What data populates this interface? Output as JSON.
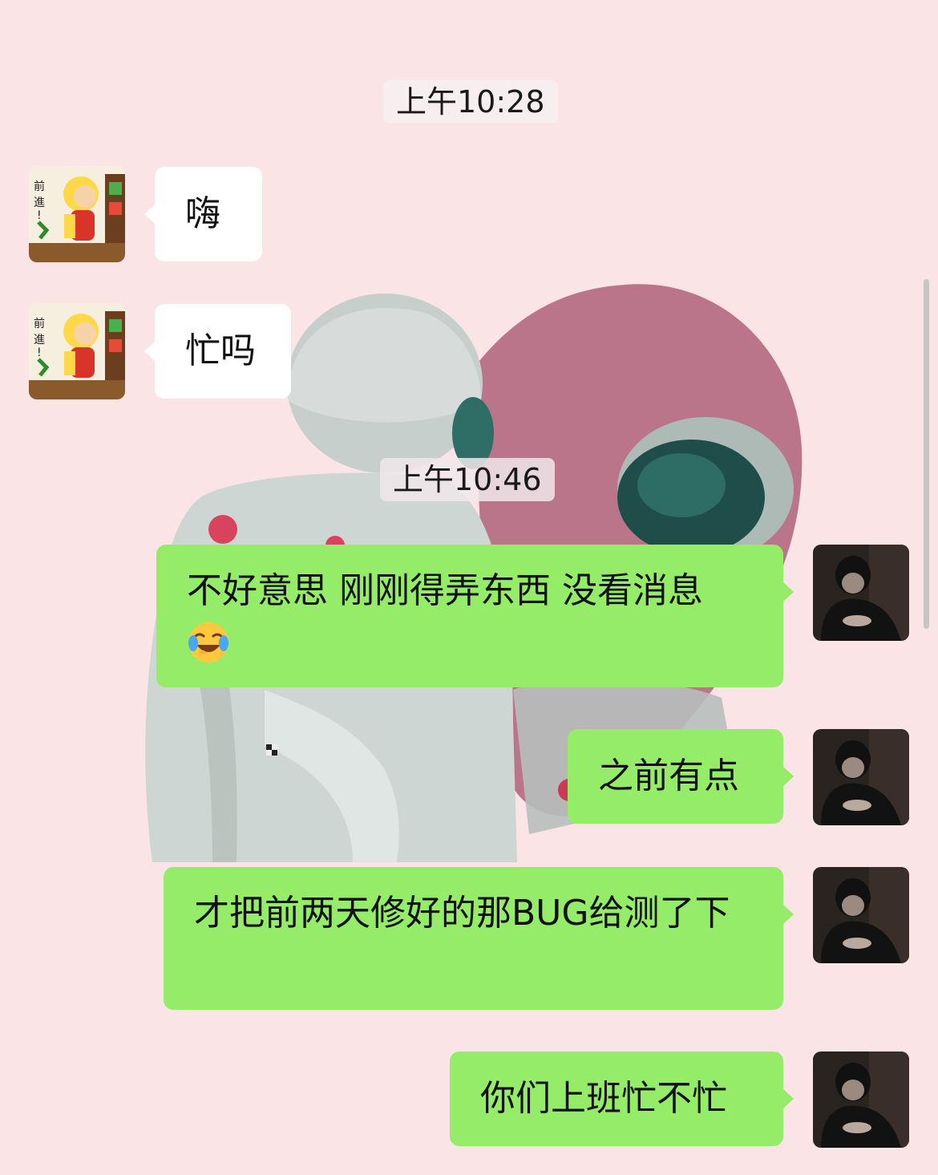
{
  "timestamps": [
    "上午10:28",
    "上午10:46"
  ],
  "messages": [
    {
      "side": "in",
      "text": "嗨"
    },
    {
      "side": "in",
      "text": "忙吗"
    },
    {
      "side": "out",
      "text": "不好意思 刚刚得弄东西 没看消息",
      "emoji": "crying-laughing-emoji"
    },
    {
      "side": "out",
      "text": "之前有点"
    },
    {
      "side": "out",
      "text": "才把前两天修好的那BUG给测了下"
    },
    {
      "side": "out",
      "text": "你们上班忙不忙"
    }
  ],
  "avatars": {
    "contact": {
      "name": "contact-avatar",
      "sticker_text": "前進!"
    },
    "self": {
      "name": "self-avatar"
    }
  },
  "colors": {
    "background": "#fbe4e6",
    "incoming_bubble": "#ffffff",
    "outgoing_bubble": "#95ec69",
    "heart": "#b3687f"
  }
}
